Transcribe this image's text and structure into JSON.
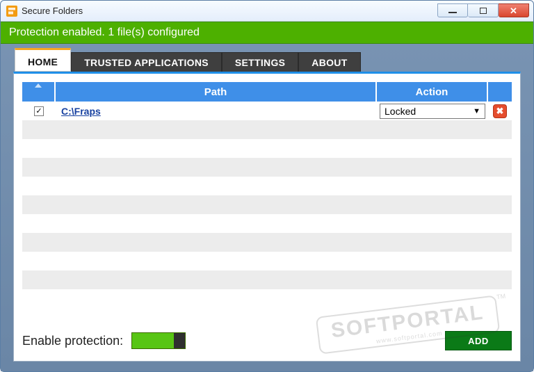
{
  "window": {
    "title": "Secure Folders"
  },
  "status": {
    "text": "Protection enabled. 1 file(s) configured"
  },
  "tabs": {
    "home": "HOME",
    "trusted": "TRUSTED APPLICATIONS",
    "settings": "SETTINGS",
    "about": "ABOUT"
  },
  "table": {
    "headers": {
      "path": "Path",
      "action": "Action"
    },
    "rows": [
      {
        "checked": true,
        "path": "C:\\Fraps",
        "action": "Locked"
      }
    ]
  },
  "footer": {
    "enable_label": "Enable protection:",
    "protection_on": true,
    "add_label": "ADD"
  },
  "watermark": {
    "name": "SOFTPORTAL",
    "url": "www.softportal.com",
    "tm": "TM"
  }
}
